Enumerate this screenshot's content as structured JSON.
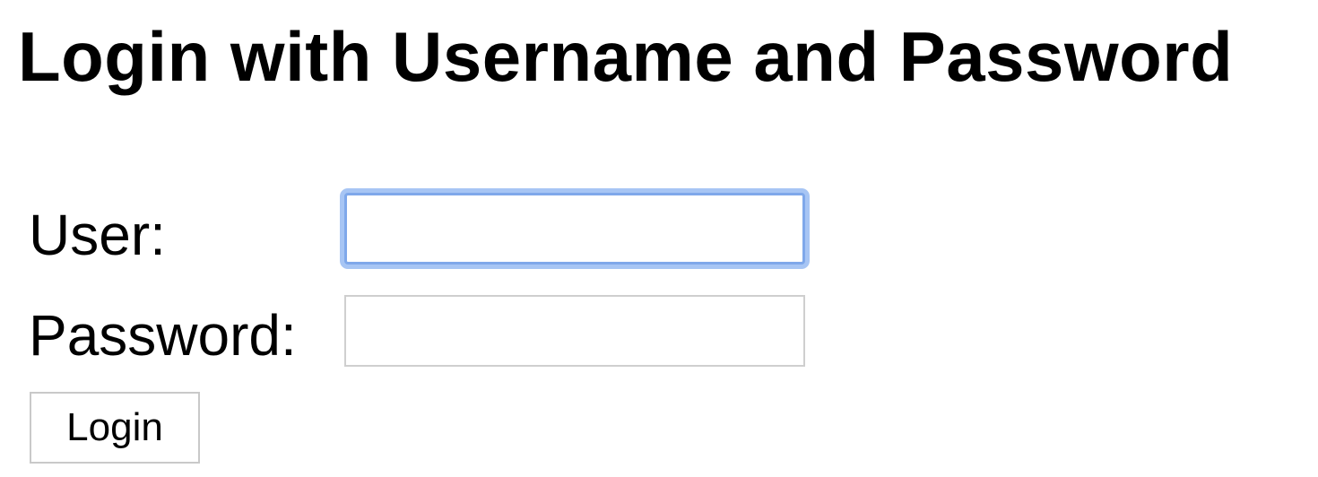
{
  "page": {
    "title": "Login with Username and Password"
  },
  "form": {
    "user_label": "User:",
    "user_value": "",
    "password_label": "Password:",
    "password_value": "",
    "login_label": "Login",
    "focused_field": "user"
  },
  "colors": {
    "focus_ring": "#a7c5f4",
    "focus_border": "#7fa8ea",
    "input_border": "#cfcfcf",
    "button_border": "#c9c9c9"
  }
}
